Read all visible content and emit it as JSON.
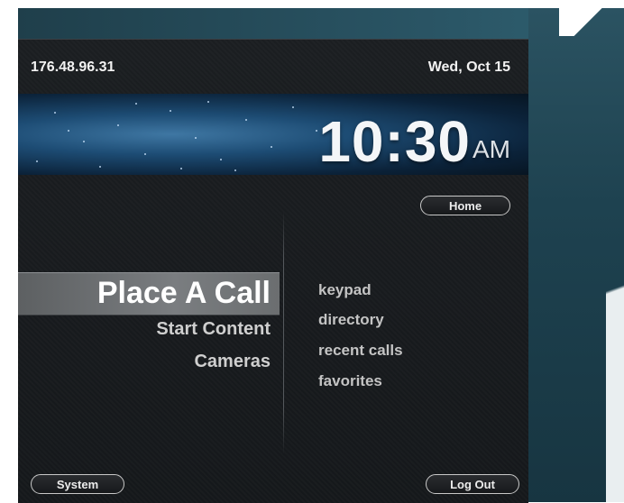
{
  "header": {
    "ip_address": "176.48.96.31",
    "date": "Wed, Oct 15"
  },
  "clock": {
    "time": "10:30",
    "ampm": "AM"
  },
  "nav": {
    "home_label": "Home"
  },
  "main_menu": {
    "items": [
      {
        "label": "Place A Call",
        "selected": true
      },
      {
        "label": "Start Content",
        "selected": false
      },
      {
        "label": "Cameras",
        "selected": false
      }
    ]
  },
  "sub_menu": {
    "items": [
      {
        "label": "keypad"
      },
      {
        "label": "directory"
      },
      {
        "label": "recent calls"
      },
      {
        "label": "favorites"
      }
    ]
  },
  "footer": {
    "system_label": "System",
    "logout_label": "Log Out"
  },
  "colors": {
    "screen_bg": "#17191b",
    "banner_blue": "#1d4c74",
    "highlight": "#6b6e70",
    "text_primary": "#f2f2f2"
  }
}
